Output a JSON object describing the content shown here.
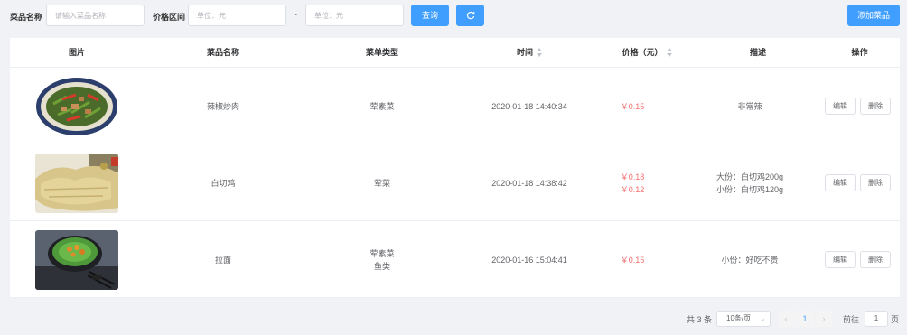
{
  "search": {
    "name_label": "菜品名称",
    "name_placeholder": "请输入菜品名称",
    "price_label": "价格区间",
    "price_min_placeholder": "单位：元",
    "price_sep": "-",
    "price_max_placeholder": "单位：元",
    "query_button": "查询",
    "refresh_icon": "refresh-icon"
  },
  "add_button": "添加菜品",
  "table": {
    "headers": {
      "image": "图片",
      "name": "菜品名称",
      "type": "菜单类型",
      "time": "时间",
      "price": "价格（元）",
      "desc": "描述",
      "actions": "操作"
    },
    "edit_label": "编辑",
    "delete_label": "删除",
    "rows": [
      {
        "name": "辣椒炒肉",
        "types": [
          "荤素菜"
        ],
        "time": "2020-01-18 14:40:34",
        "prices": [
          "￥0.15"
        ],
        "descs": [
          "非常辣"
        ]
      },
      {
        "name": "白切鸡",
        "types": [
          "荤菜"
        ],
        "time": "2020-01-18 14:38:42",
        "prices": [
          "￥0.18",
          "￥0.12"
        ],
        "descs": [
          "大份：白切鸡200g",
          "小份：白切鸡120g"
        ]
      },
      {
        "name": "拉面",
        "types": [
          "荤素菜",
          "鱼类"
        ],
        "time": "2020-01-16 15:04:41",
        "prices": [
          "￥0.15"
        ],
        "descs": [
          "小份：好吃不贵"
        ]
      }
    ]
  },
  "pagination": {
    "total": "共 3 条",
    "page_size": "10条/页",
    "prev": "‹",
    "current_page": "1",
    "next": "›",
    "goto_label": "前往",
    "goto_value": "1",
    "page_suffix": "页"
  },
  "colors": {
    "primary": "#409eff",
    "price": "#f56c6c",
    "background": "#f0f2f5"
  }
}
